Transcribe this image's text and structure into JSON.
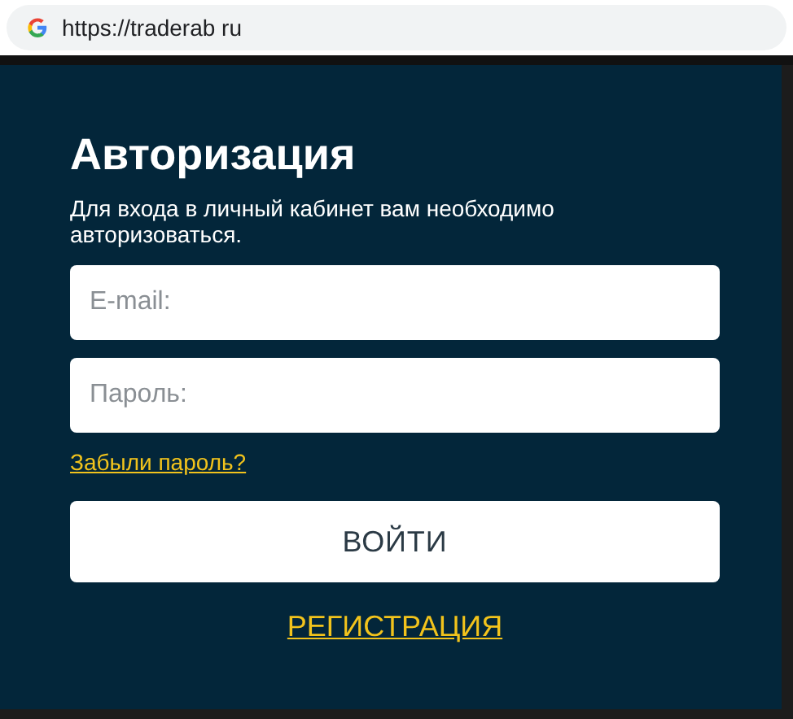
{
  "browser": {
    "url": "https://traderab ru"
  },
  "login": {
    "title": "Авторизация",
    "subtitle": "Для входа в личный кабинет вам необходимо авторизоваться.",
    "fields": [
      {
        "placeholder": "E-mail:"
      },
      {
        "placeholder": "Пароль:"
      }
    ],
    "forgot_link": "Забыли пароль?",
    "submit_button": "ВОЙТИ",
    "register_link": "РЕГИСТРАЦИЯ"
  }
}
